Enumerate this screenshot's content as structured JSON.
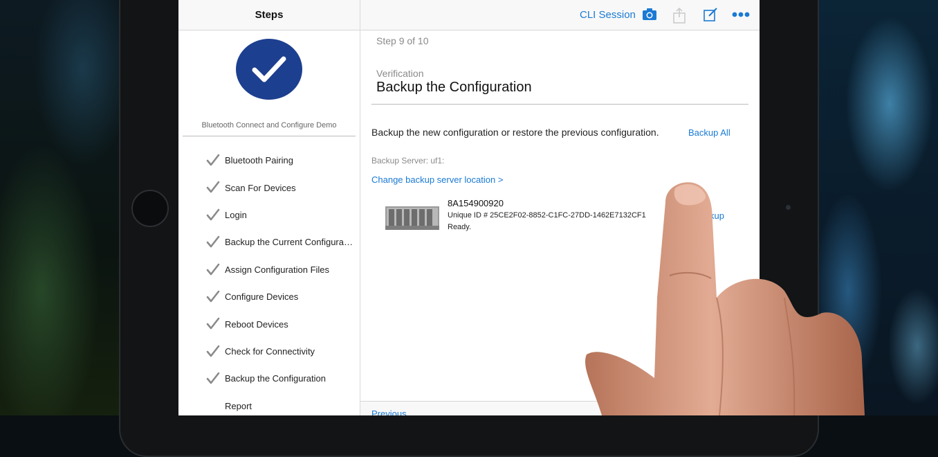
{
  "sidebar": {
    "title": "Steps",
    "demo_title": "Bluetooth Connect and Configure Demo",
    "steps": [
      {
        "label": "Bluetooth Pairing",
        "done": true
      },
      {
        "label": "Scan For Devices",
        "done": true
      },
      {
        "label": "Login",
        "done": true
      },
      {
        "label": "Backup the Current Configurat...",
        "done": true
      },
      {
        "label": "Assign Configuration Files",
        "done": true
      },
      {
        "label": "Configure Devices",
        "done": true
      },
      {
        "label": "Reboot Devices",
        "done": true
      },
      {
        "label": "Check for Connectivity",
        "done": true
      },
      {
        "label": "Backup the Configuration",
        "done": true
      },
      {
        "label": "Report",
        "done": false
      }
    ]
  },
  "toolbar": {
    "cli_session": "CLI Session",
    "icons": [
      "camera-icon",
      "share-icon",
      "compose-icon",
      "more-icon"
    ]
  },
  "main": {
    "step_count": "Step 9 of 10",
    "section": "Verification",
    "title": "Backup the Configuration",
    "intro": "Backup the new configuration or restore the previous configuration.",
    "backup_all": "Backup All",
    "server_label": "Backup Server: uf1:",
    "change_location": "Change backup server location >",
    "device": {
      "name": "8A154900920",
      "unique_id": "Unique ID # 25CE2F02-8852-C1FC-27DD-1462E7132CF1",
      "status": "Ready.",
      "backup_partial": "kup"
    },
    "previous": "Previous"
  },
  "colors": {
    "accent": "#1a7ad4",
    "check_circle": "#1d3f8f"
  }
}
